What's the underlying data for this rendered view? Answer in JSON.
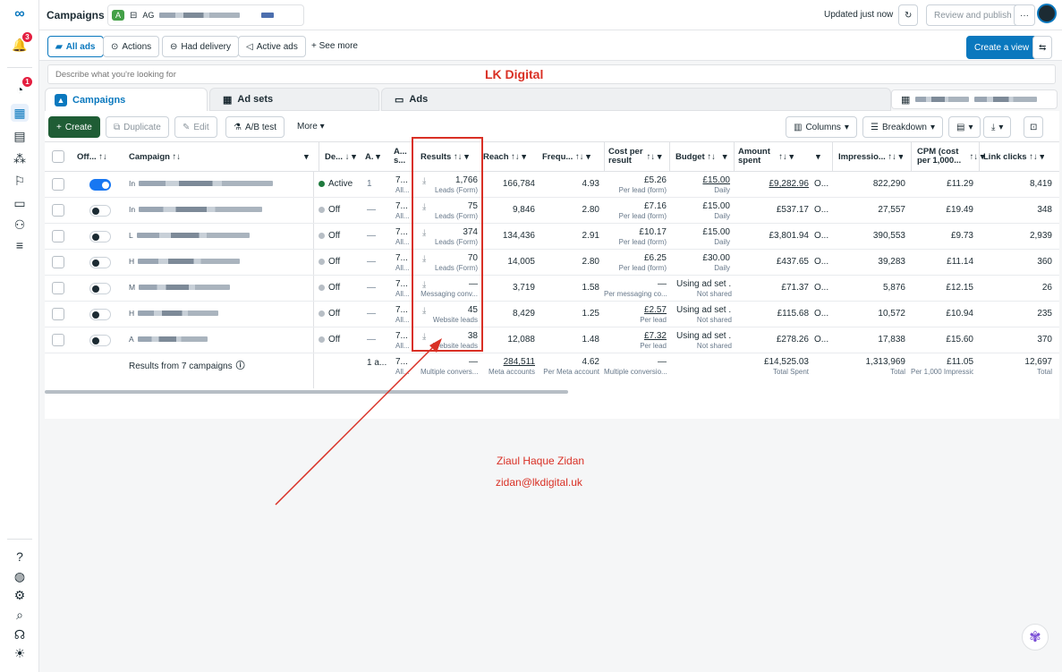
{
  "topbar": {
    "title": "Campaigns",
    "account_badge": "A",
    "account_prefix": "AG",
    "updated": "Updated just now",
    "review_publish": "Review and publish",
    "more": "···"
  },
  "filters": {
    "all_ads": "All ads",
    "actions": "Actions",
    "had_delivery": "Had delivery",
    "active_ads": "Active ads",
    "see_more": "See more",
    "create_view": "Create a view"
  },
  "search": {
    "placeholder": "Describe what you're looking for"
  },
  "watermark_top": "LK Digital",
  "tabs": {
    "campaigns": "Campaigns",
    "ad_sets": "Ad sets",
    "ads": "Ads"
  },
  "toolbar": {
    "create": "Create",
    "duplicate": "Duplicate",
    "edit": "Edit",
    "ab_test": "A/B test",
    "more": "More",
    "columns": "Columns",
    "breakdown": "Breakdown"
  },
  "columns": {
    "off_on": "Off... ↑↓",
    "campaign": "Campaign ↑↓",
    "delivery": "De... ↓",
    "attribution": "A.",
    "ad_set": "A... s...",
    "results": "Results ↑↓",
    "reach": "Reach ↑↓",
    "frequency": "Frequ... ↑↓",
    "cost_per_result": "Cost per result",
    "budget": "Budget ↑↓",
    "amount_spent": "Amount spent",
    "impressions": "Impressio... ↑↓",
    "cpm": "CPM (cost per 1,000...",
    "link_clicks": "Link clicks ↑↓"
  },
  "rows": [
    {
      "name_prefix": "In",
      "on": true,
      "delivery": "Active",
      "attr": "1",
      "adset": "7...",
      "adset_sub": "All...",
      "results": "1,766",
      "results_sub": "Leads (Form)",
      "reach": "166,784",
      "freq": "4.93",
      "cpr": "£5.26",
      "cpr_sub": "Per lead (form)",
      "budget": "£15.00",
      "budget_sub": "Daily",
      "spent": "£9,282.96",
      "ends": "O...",
      "impr": "822,290",
      "cpm": "£11.29",
      "clicks": "8,419"
    },
    {
      "name_prefix": "In",
      "on": false,
      "delivery": "Off",
      "attr": "—",
      "adset": "7...",
      "adset_sub": "All...",
      "results": "75",
      "results_sub": "Leads (Form)",
      "reach": "9,846",
      "freq": "2.80",
      "cpr": "£7.16",
      "cpr_sub": "Per lead (form)",
      "budget": "£15.00",
      "budget_sub": "Daily",
      "spent": "£537.17",
      "ends": "O...",
      "impr": "27,557",
      "cpm": "£19.49",
      "clicks": "348"
    },
    {
      "name_prefix": "L",
      "on": false,
      "delivery": "Off",
      "attr": "—",
      "adset": "7...",
      "adset_sub": "All...",
      "results": "374",
      "results_sub": "Leads (Form)",
      "reach": "134,436",
      "freq": "2.91",
      "cpr": "£10.17",
      "cpr_sub": "Per lead (form)",
      "budget": "£15.00",
      "budget_sub": "Daily",
      "spent": "£3,801.94",
      "ends": "O...",
      "impr": "390,553",
      "cpm": "£9.73",
      "clicks": "2,939"
    },
    {
      "name_prefix": "H",
      "on": false,
      "delivery": "Off",
      "attr": "—",
      "adset": "7...",
      "adset_sub": "All...",
      "results": "70",
      "results_sub": "Leads (Form)",
      "reach": "14,005",
      "freq": "2.80",
      "cpr": "£6.25",
      "cpr_sub": "Per lead (form)",
      "budget": "£30.00",
      "budget_sub": "Daily",
      "spent": "£437.65",
      "ends": "O...",
      "impr": "39,283",
      "cpm": "£11.14",
      "clicks": "360"
    },
    {
      "name_prefix": "M",
      "on": false,
      "delivery": "Off",
      "attr": "—",
      "adset": "7...",
      "adset_sub": "All...",
      "results": "—",
      "results_sub": "Messaging conv...",
      "reach": "3,719",
      "freq": "1.58",
      "cpr": "—",
      "cpr_sub": "Per messaging co...",
      "budget": "Using ad set ...",
      "budget_sub": "Not shared",
      "spent": "£71.37",
      "ends": "O...",
      "impr": "5,876",
      "cpm": "£12.15",
      "clicks": "26"
    },
    {
      "name_prefix": "H",
      "on": false,
      "delivery": "Off",
      "attr": "—",
      "adset": "7...",
      "adset_sub": "All...",
      "results": "45",
      "results_sub": "Website leads",
      "reach": "8,429",
      "freq": "1.25",
      "cpr": "£2.57",
      "cpr_sub": "Per lead",
      "budget": "Using ad set ...",
      "budget_sub": "Not shared",
      "spent": "£115.68",
      "ends": "O...",
      "impr": "10,572",
      "cpm": "£10.94",
      "clicks": "235"
    },
    {
      "name_prefix": "A",
      "on": false,
      "delivery": "Off",
      "attr": "—",
      "adset": "7...",
      "adset_sub": "All...",
      "results": "38",
      "results_sub": "Website leads",
      "reach": "12,088",
      "freq": "1.48",
      "cpr": "£7.32",
      "cpr_sub": "Per lead",
      "budget": "Using ad set ...",
      "budget_sub": "Not shared",
      "spent": "£278.26",
      "ends": "O...",
      "impr": "17,838",
      "cpm": "£15.60",
      "clicks": "370"
    }
  ],
  "totals": {
    "label": "Results from 7 campaigns",
    "attr": "1 a...",
    "adset": "7...",
    "adset_sub": "All...",
    "results": "—",
    "results_sub": "Multiple convers...",
    "reach": "284,511",
    "reach_sub": "Meta accounts",
    "freq": "4.62",
    "freq_sub": "Per Meta account",
    "cpr": "—",
    "cpr_sub": "Multiple conversio...",
    "spent": "£14,525.03",
    "spent_sub": "Total Spent",
    "impr": "1,313,969",
    "impr_sub": "Total",
    "cpm": "£11.05",
    "cpm_sub": "Per 1,000 Impressio...",
    "clicks": "12,697",
    "clicks_sub": "Total"
  },
  "annotation": {
    "name": "Ziaul Haque Zidan",
    "email": "zidan@lkdigital.uk",
    "color": "#d93025"
  }
}
